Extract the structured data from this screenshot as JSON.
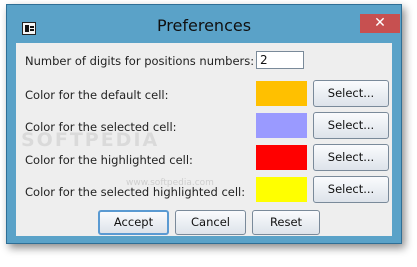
{
  "window": {
    "title": "Preferences",
    "close_glyph": "✕",
    "app_icon": "app-icon"
  },
  "fields": {
    "digits_label": "Number of digits for positions numbers:",
    "digits_value": "2",
    "colors": [
      {
        "label": "Color for the default cell:",
        "color": "#ffc000",
        "button": "Select..."
      },
      {
        "label": "Color for the selected cell:",
        "color": "#9a9aff",
        "button": "Select..."
      },
      {
        "label": "Color for the highlighted cell:",
        "color": "#ff0000",
        "button": "Select..."
      },
      {
        "label": "Color for the selected highlighted cell:",
        "color": "#ffff00",
        "button": "Select..."
      }
    ]
  },
  "footer": {
    "accept": "Accept",
    "cancel": "Cancel",
    "reset": "Reset"
  },
  "watermark": {
    "brand": "SOFTPEDIA",
    "url": "www.softpedia.com"
  }
}
